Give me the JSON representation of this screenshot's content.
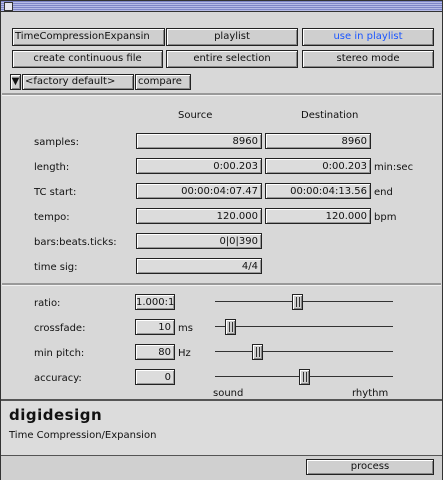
{
  "top_buttons": {
    "plugin": "TimeCompressionExpansin",
    "playlist": "playlist",
    "use_in_playlist": "use in playlist",
    "create_continuous": "create continuous file",
    "entire_selection": "entire selection",
    "stereo_mode": "stereo mode"
  },
  "preset": {
    "menu": "<factory default>",
    "compare": "compare"
  },
  "columns": {
    "source": "Source",
    "destination": "Destination"
  },
  "fields": {
    "samples": {
      "label": "samples:",
      "source": "8960",
      "dest": "8960"
    },
    "length": {
      "label": "length:",
      "source": "0:00.203",
      "dest": "0:00.203",
      "unit": "min:sec"
    },
    "tc_start": {
      "label": "TC start:",
      "source": "00:00:04:07.47",
      "dest": "00:00:04:13.56",
      "unit": "end"
    },
    "tempo": {
      "label": "tempo:",
      "source": "120.000",
      "dest": "120.000",
      "unit": "bpm"
    },
    "bars": {
      "label": "bars:beats.ticks:",
      "source": "0|0|390"
    },
    "time_sig": {
      "label": "time sig:",
      "source": "4/4"
    }
  },
  "params": {
    "ratio": {
      "label": "ratio:",
      "value": "1.000:1",
      "slider": 0.46
    },
    "crossfade": {
      "label": "crossfade:",
      "value": "10",
      "unit": "ms",
      "slider": 0.06
    },
    "min_pitch": {
      "label": "min pitch:",
      "value": "80",
      "unit": "Hz",
      "slider": 0.22
    },
    "accuracy": {
      "label": "accuracy:",
      "value": "0",
      "slider": 0.5,
      "left": "sound",
      "right": "rhythm"
    }
  },
  "brand": {
    "logo": "digidesign",
    "subtitle": "Time Compression/Expansion"
  },
  "process_button": "process",
  "colors": {
    "accent": "#1a55ff",
    "titlebar": "#9aa0d6"
  }
}
